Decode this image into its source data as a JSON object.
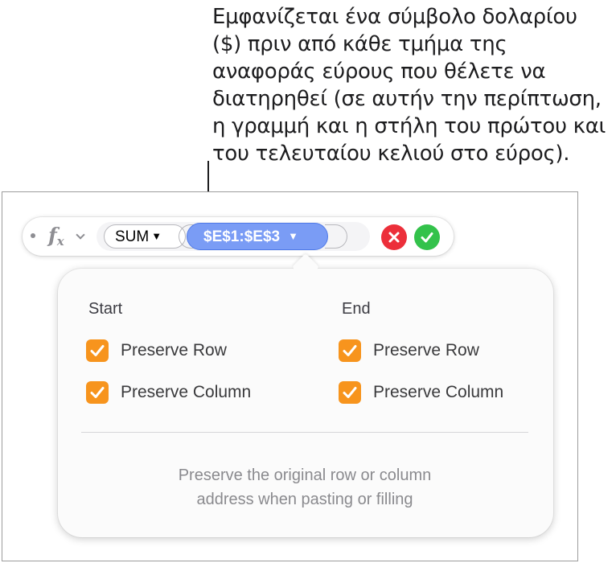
{
  "callout": {
    "lines": [
      "Εμφανίζεται ένα σύμβολο δολαρίου",
      "($) πριν από κάθε τμήμα της",
      "αναφοράς εύρους που θέλετε να",
      "διατηρηθεί (σε αυτήν την περίπτωση,",
      "η γραμμή και η στήλη του πρώτου και",
      "του τελευταίου κελιού στο εύρος)."
    ]
  },
  "formula_bar": {
    "fx_label": "f",
    "fx_sub": "x",
    "function_name": "SUM",
    "range_value": "$E$1:$E$3",
    "dropdown_caret": "▼"
  },
  "popover": {
    "start": {
      "heading": "Start",
      "preserve_row": {
        "label": "Preserve Row",
        "checked": true
      },
      "preserve_column": {
        "label": "Preserve Column",
        "checked": true
      }
    },
    "end": {
      "heading": "End",
      "preserve_row": {
        "label": "Preserve Row",
        "checked": true
      },
      "preserve_column": {
        "label": "Preserve Column",
        "checked": true
      }
    },
    "help_lines": [
      "Preserve the original row or column",
      "address when pasting or filling"
    ]
  },
  "colors": {
    "checkbox_accent": "#f7941d",
    "range_token": "#7a9cf5",
    "cancel": "#ec2f3a",
    "confirm": "#33c24b"
  },
  "icons": {
    "fx": "function-icon",
    "chevron": "chevron-down-icon",
    "cancel": "close-icon",
    "confirm": "checkmark-icon"
  }
}
